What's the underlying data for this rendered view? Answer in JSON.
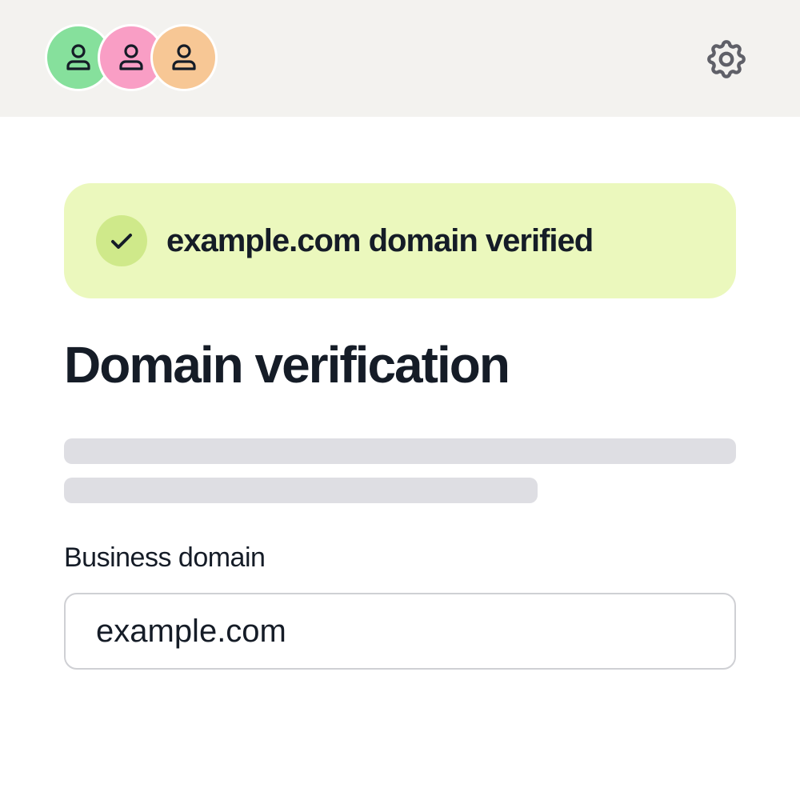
{
  "header": {
    "avatars": [
      {
        "icon": "user-icon",
        "color": "#86e09c"
      },
      {
        "icon": "user-icon",
        "color": "#f99ec5"
      },
      {
        "icon": "user-icon",
        "color": "#f7c795"
      }
    ],
    "settings_icon": "gear-icon"
  },
  "banner": {
    "text": "example.com domain verified",
    "icon": "check-icon",
    "background": "#ebf8bd",
    "badge_color": "#cfe98a"
  },
  "main": {
    "title": "Domain verification",
    "skeleton_color": "#dedee3",
    "field": {
      "label": "Business domain",
      "value": "example.com"
    }
  }
}
